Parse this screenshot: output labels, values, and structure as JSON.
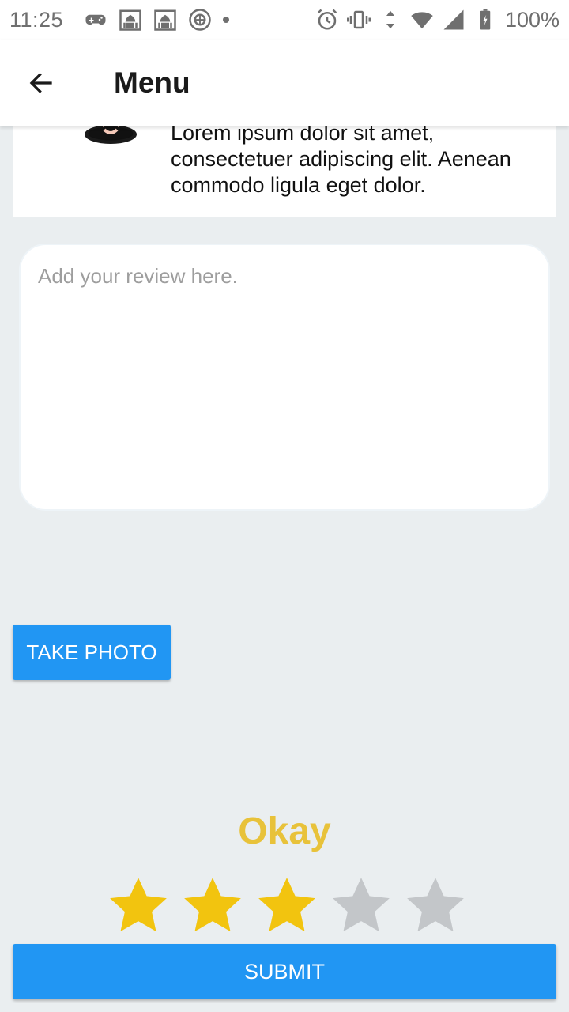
{
  "status_bar": {
    "time": "11:25",
    "battery": "100%",
    "left_icons": [
      "game-controller-icon",
      "mosque-icon",
      "mosque-icon",
      "emblem-icon"
    ],
    "right_icons": [
      "alarm-icon",
      "vibrate-icon",
      "wifi-icon",
      "signal-icon",
      "battery-icon"
    ]
  },
  "app_bar": {
    "title": "Menu",
    "back_icon": "arrow-left-icon"
  },
  "review_card": {
    "text": "Lorem ipsum dolor sit amet, consectetuer adipiscing elit. Aenean commodo ligula eget dolor."
  },
  "review_input": {
    "placeholder": "Add your review here.",
    "value": ""
  },
  "take_photo_label": "TAKE PHOTO",
  "rating": {
    "label": "Okay",
    "value": 3,
    "max": 5,
    "filled_color": "#f2c40f",
    "empty_color": "#c3c6c9",
    "label_color": "#e8c23a"
  },
  "submit_label": "SUBMIT",
  "colors": {
    "primary": "#2196f3",
    "background": "#eaeef0"
  }
}
